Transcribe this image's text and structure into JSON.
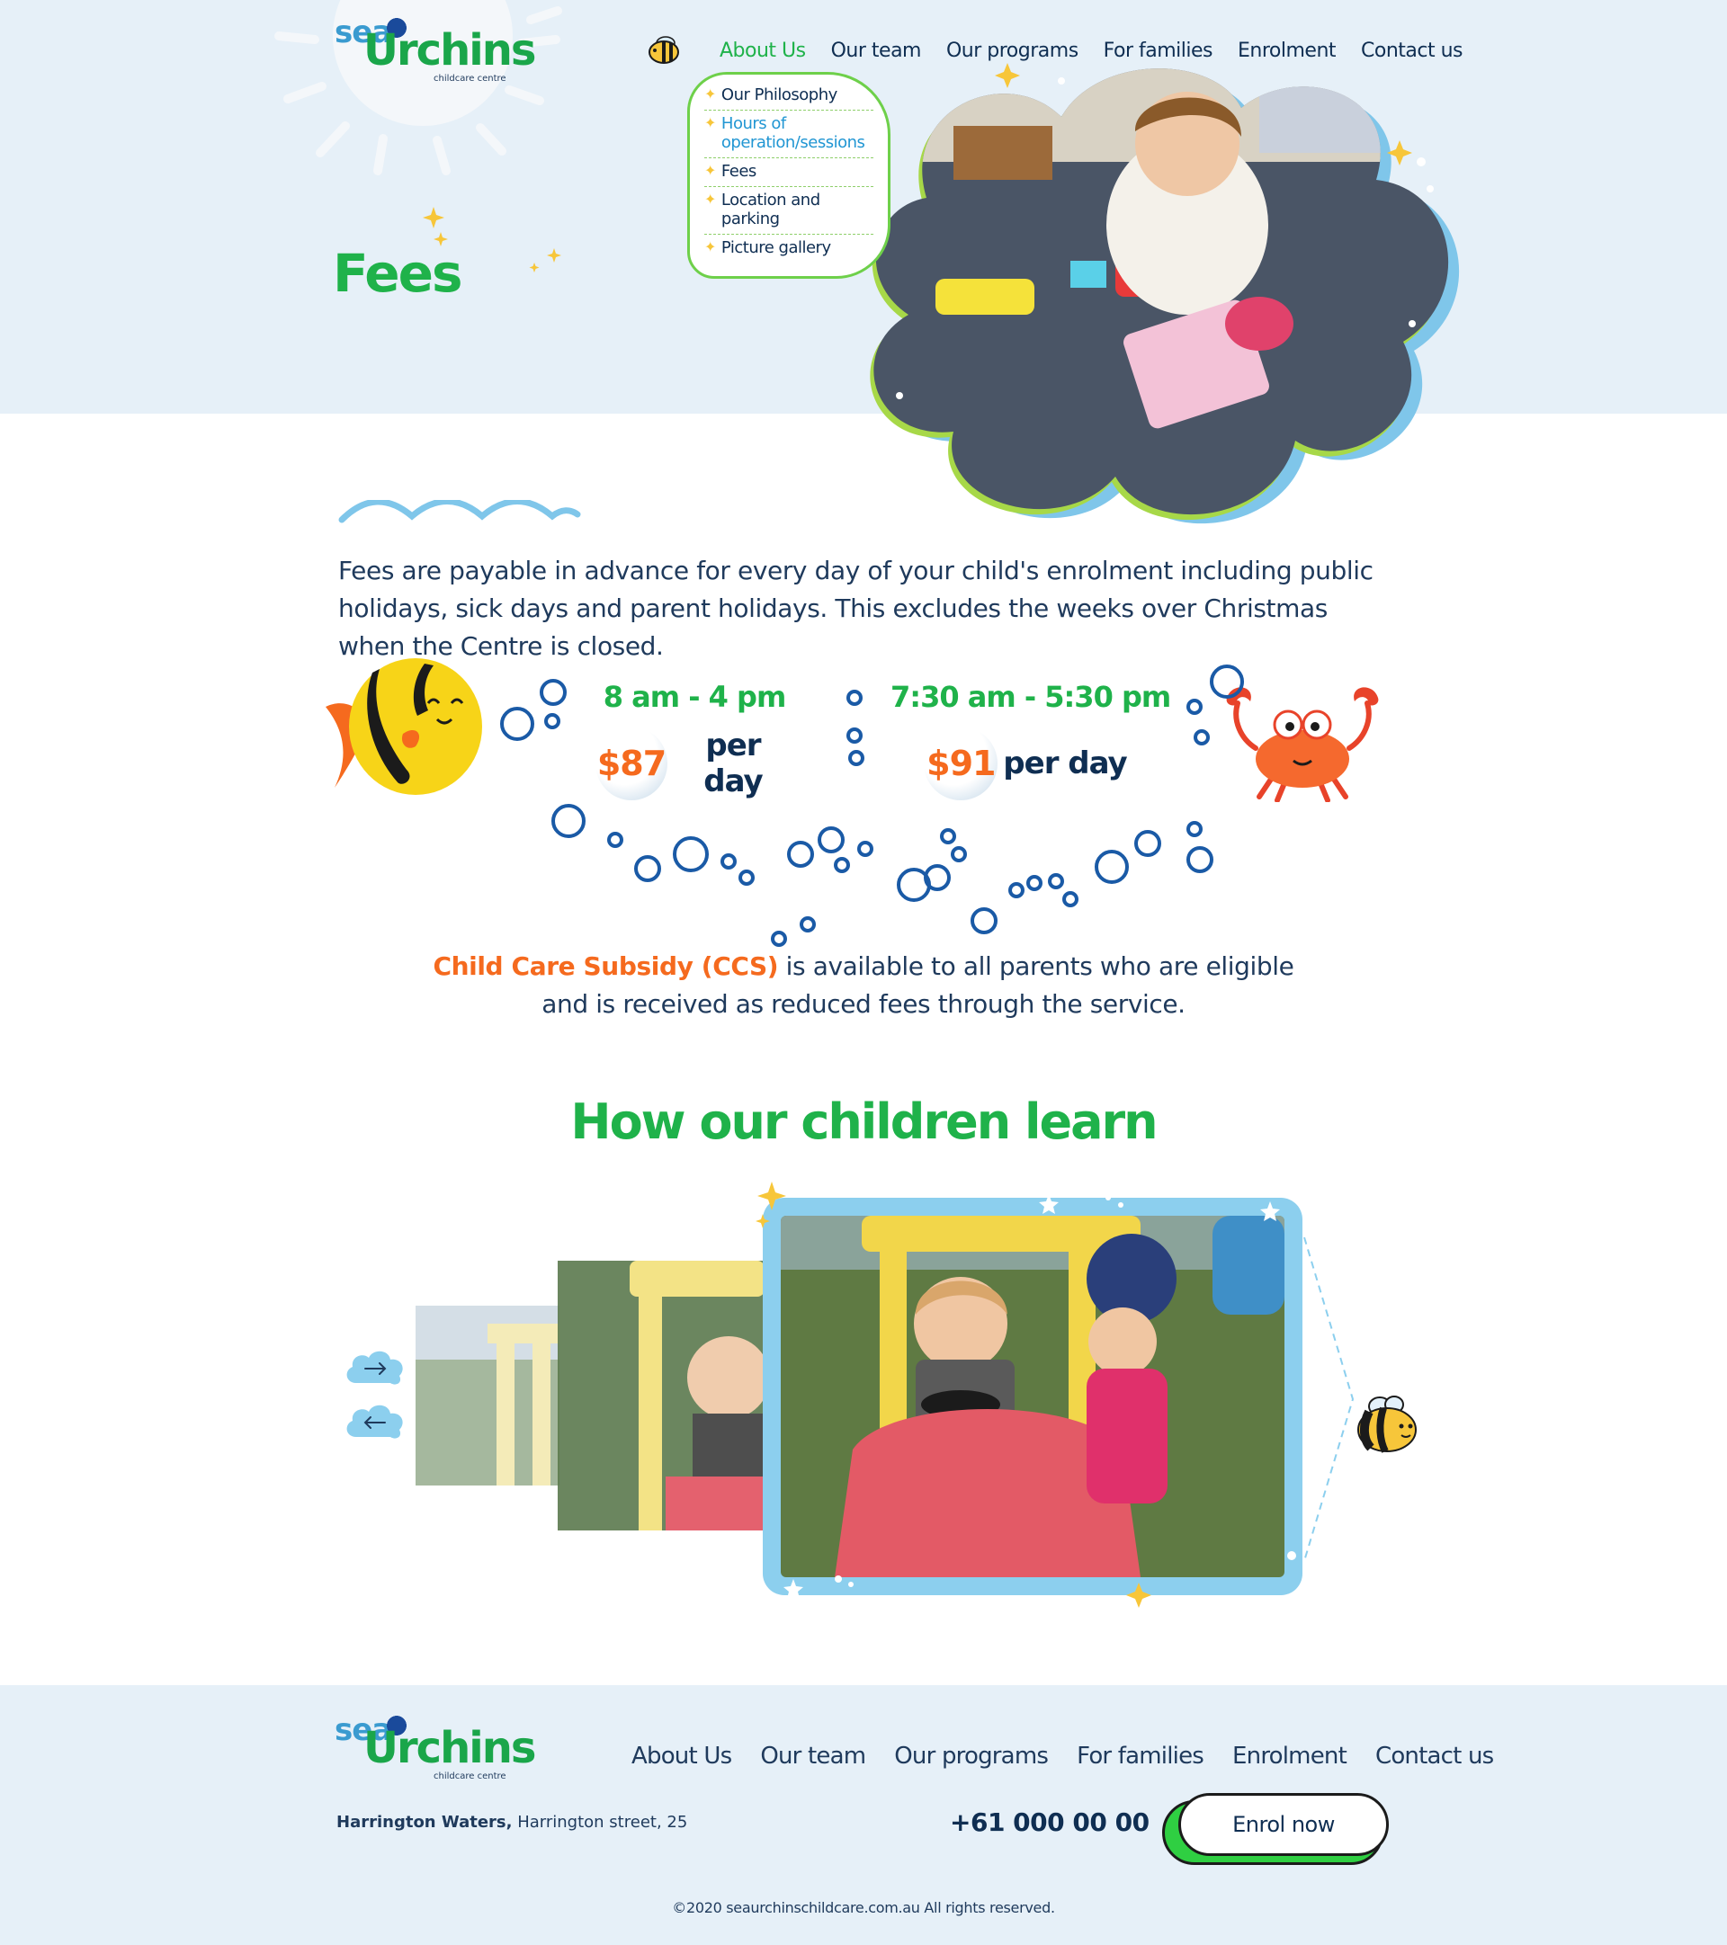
{
  "brand": {
    "logo_top": "sea",
    "logo_main": "Urchins",
    "logo_sub": "childcare centre"
  },
  "nav": {
    "items": [
      {
        "label": "About Us",
        "active": true
      },
      {
        "label": "Our team"
      },
      {
        "label": "Our programs"
      },
      {
        "label": "For families"
      },
      {
        "label": "Enrolment"
      },
      {
        "label": "Contact us"
      }
    ]
  },
  "dropdown": {
    "items": [
      {
        "label": "Our Philosophy"
      },
      {
        "label": "Hours of operation/sessions",
        "highlight": true
      },
      {
        "label": "Fees"
      },
      {
        "label": "Location and parking"
      },
      {
        "label": "Picture gallery"
      }
    ]
  },
  "page": {
    "title": "Fees",
    "intro": "Fees are payable in advance for every day of your child's enrolment including public holidays, sick days and parent holidays. This excludes the weeks over Christmas when the Centre is closed."
  },
  "prices": [
    {
      "time": "8 am - 4 pm",
      "amount": "$87",
      "unit": "per day"
    },
    {
      "time": "7:30 am - 5:30 pm",
      "amount": "$91",
      "unit": "per day"
    }
  ],
  "ccs": {
    "highlight": "Child Care Subsidy (CCS)",
    "text": " is available to all parents who are eligible and is received as reduced fees through the service."
  },
  "learn": {
    "title": "How our children learn"
  },
  "footer": {
    "nav": [
      "About Us",
      "Our team",
      "Our programs",
      "For families",
      "Enrolment",
      "Contact us"
    ],
    "address_bold": "Harrington Waters,",
    "address_rest": " Harrington street, 25",
    "phone": "+61 000 00 00",
    "enrol_label": "Enrol now",
    "copyright": "©2020 seaurchinschildcare.com.au All rights reserved."
  },
  "colors": {
    "brand_green": "#1fb24a",
    "accent_orange": "#f56a1e",
    "sky_blue": "#8ccfee",
    "band": "#e6f0f8",
    "navy": "#0f2e52"
  },
  "icons": [
    "bee-icon",
    "star-icon",
    "fish-icon",
    "crab-icon",
    "arrow-right-icon",
    "arrow-left-icon"
  ]
}
